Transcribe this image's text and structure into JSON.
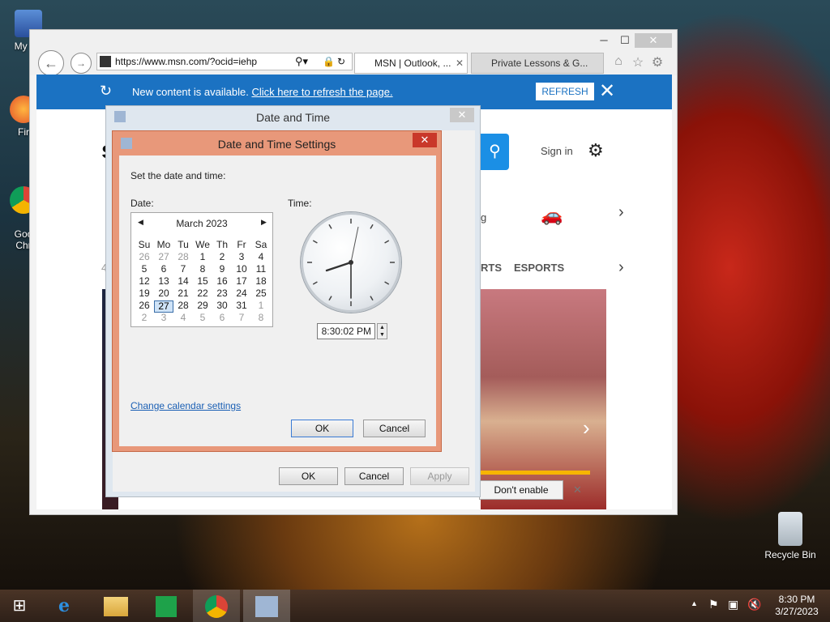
{
  "desktop": {
    "icons": [
      {
        "label": "My Co"
      },
      {
        "label": "Fir"
      },
      {
        "label": "Goo\nChr"
      }
    ],
    "recycle_bin": "Recycle Bin"
  },
  "ie": {
    "address": "https://www.msn.com/?ocid=iehp",
    "tabs": [
      {
        "label": "MSN | Outlook, ..."
      },
      {
        "label": "Private Lessons & G..."
      }
    ],
    "notification": {
      "message": "New content is available.",
      "link": "Click here to refresh the page.",
      "refresh_button": "REFRESH"
    },
    "page": {
      "sign_in": "Sign in",
      "esports": "ESPORTS",
      "rts": "RTS",
      "g_letter": "g",
      "e_letter": "e",
      "dont_enable": "Don't enable",
      "num4": "4",
      "s_letter": "s"
    }
  },
  "date_time": {
    "title": "Date and Time",
    "ok": "OK",
    "cancel": "Cancel",
    "apply": "Apply"
  },
  "settings": {
    "title": "Date and Time Settings",
    "instruction": "Set the date and time:",
    "date_label": "Date:",
    "time_label": "Time:",
    "calendar": {
      "month": "March 2023",
      "weekdays": [
        "Su",
        "Mo",
        "Tu",
        "We",
        "Th",
        "Fr",
        "Sa"
      ],
      "weeks": [
        [
          "26",
          "27",
          "28",
          "1",
          "2",
          "3",
          "4"
        ],
        [
          "5",
          "6",
          "7",
          "8",
          "9",
          "10",
          "11"
        ],
        [
          "12",
          "13",
          "14",
          "15",
          "16",
          "17",
          "18"
        ],
        [
          "19",
          "20",
          "21",
          "22",
          "23",
          "24",
          "25"
        ],
        [
          "26",
          "27",
          "28",
          "29",
          "30",
          "31",
          "1"
        ],
        [
          "2",
          "3",
          "4",
          "5",
          "6",
          "7",
          "8"
        ]
      ],
      "selected": "27"
    },
    "time_value": "8:30:02 PM",
    "change_calendar": "Change calendar settings",
    "ok": "OK",
    "cancel": "Cancel"
  },
  "taskbar": {
    "time": "8:30 PM",
    "date": "3/27/2023"
  }
}
